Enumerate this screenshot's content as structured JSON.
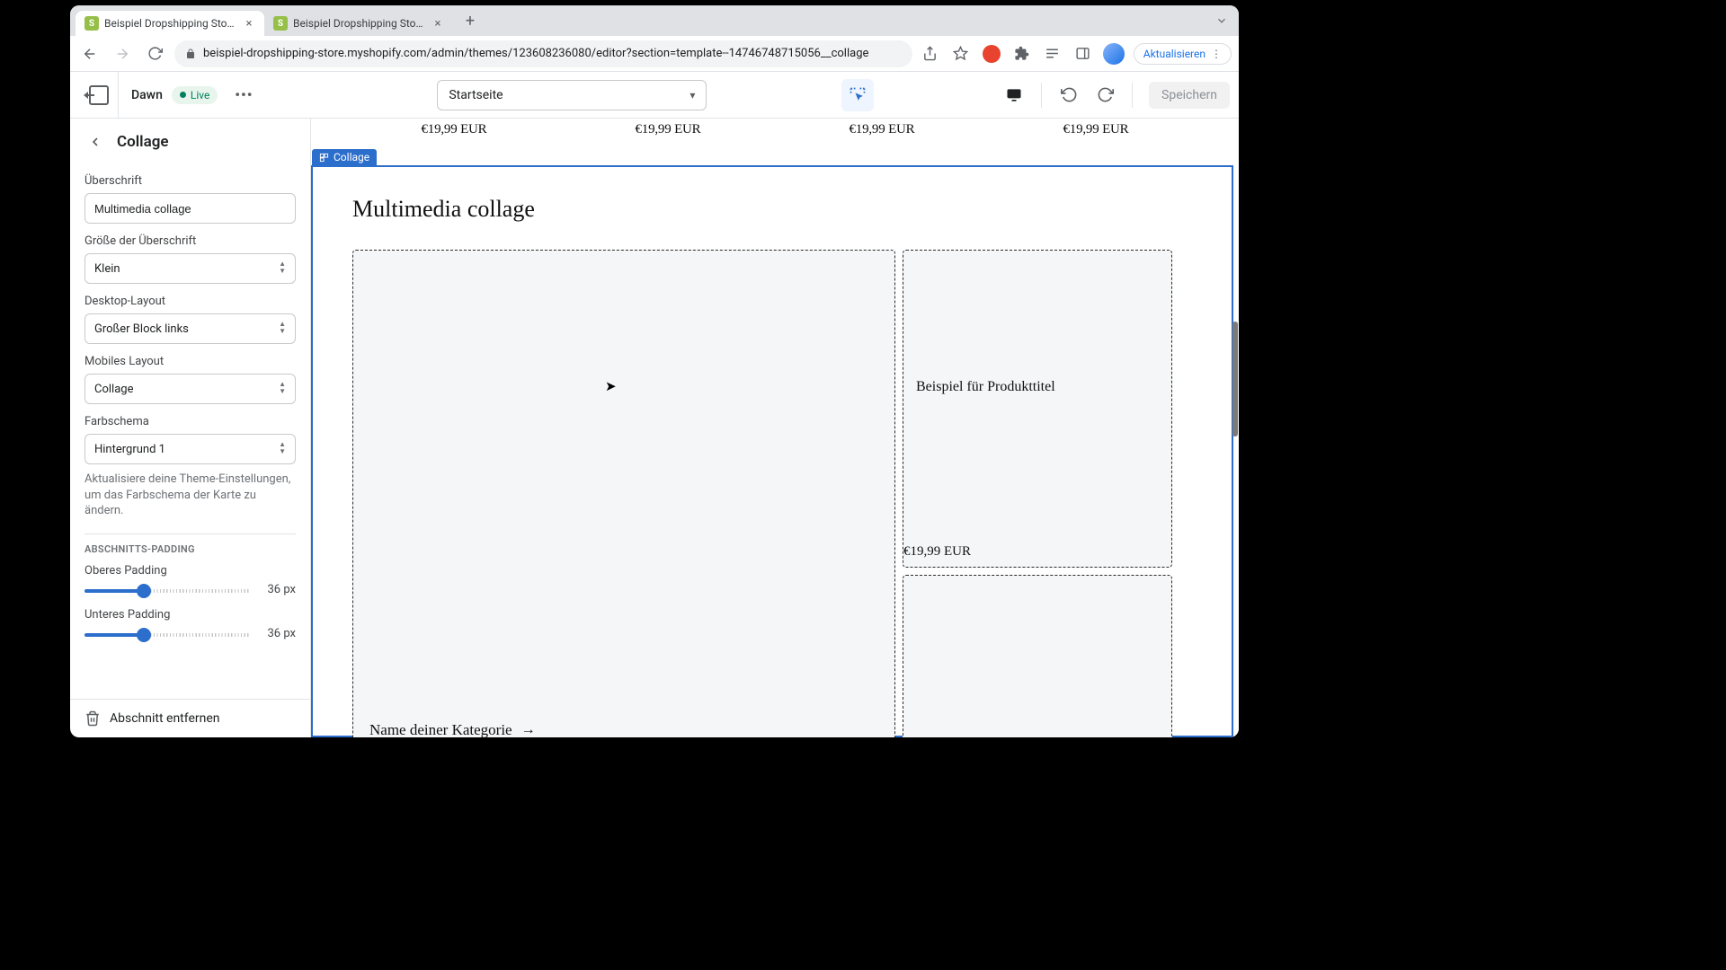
{
  "browser": {
    "tabs": [
      {
        "title": "Beispiel Dropshipping Store · D"
      },
      {
        "title": "Beispiel Dropshipping Store · E"
      }
    ],
    "url": "beispiel-dropshipping-store.myshopify.com/admin/themes/123608236080/editor?section=template--14746748715056__collage",
    "update_label": "Aktualisieren"
  },
  "topbar": {
    "theme": "Dawn",
    "live": "Live",
    "page": "Startseite",
    "save": "Speichern"
  },
  "panel": {
    "title": "Collage",
    "heading_label": "Überschrift",
    "heading_value": "Multimedia collage",
    "heading_size_label": "Größe der Überschrift",
    "heading_size_value": "Klein",
    "desktop_layout_label": "Desktop-Layout",
    "desktop_layout_value": "Großer Block links",
    "mobile_layout_label": "Mobiles Layout",
    "mobile_layout_value": "Collage",
    "color_scheme_label": "Farbschema",
    "color_scheme_value": "Hintergrund 1",
    "color_scheme_hint": "Aktualisiere deine Theme-Einstellungen, um das Farbschema der Karte zu ändern.",
    "section_padding_cap": "ABSCHNITTS-PADDING",
    "pad_top_label": "Oberes Padding",
    "pad_top_value": "36 px",
    "pad_bot_label": "Unteres Padding",
    "pad_bot_value": "36 px",
    "remove_label": "Abschnitt entfernen"
  },
  "preview": {
    "prices": [
      "€19,99 EUR",
      "€19,99 EUR",
      "€19,99 EUR",
      "€19,99 EUR"
    ],
    "collage_tag": "Collage",
    "collage_heading": "Multimedia collage",
    "category_name": "Name deiner Kategorie",
    "product_title": "Beispiel für Produkttitel",
    "product_price": "€19,99 EUR"
  }
}
